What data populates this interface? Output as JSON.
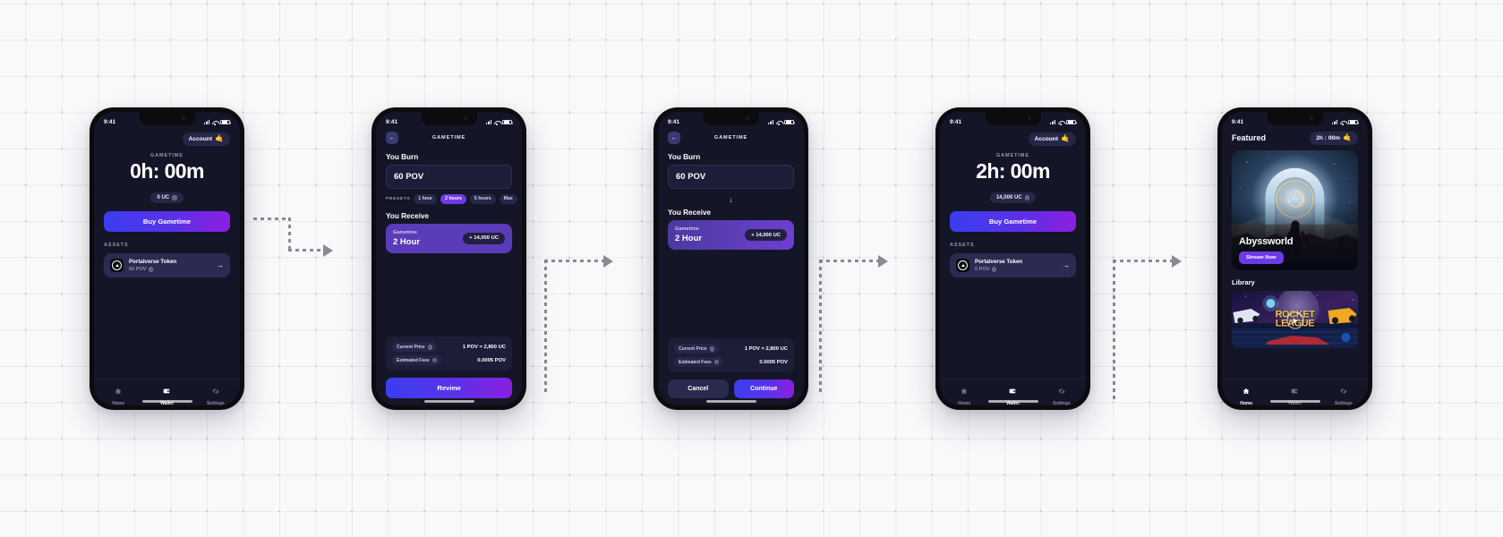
{
  "status_bar": {
    "time": "9:41"
  },
  "connectors": {
    "arrow_color": "#8a8a92"
  },
  "screens": [
    {
      "id": "wallet-empty",
      "header": {
        "account_label": "Account",
        "account_emoji": "🤙"
      },
      "gametime": {
        "caption": "GAMETIME",
        "value": "0h: 00m",
        "balance_pill": "0 UC"
      },
      "primary_button": "Buy Gametime",
      "assets": {
        "title": "ASSETS",
        "items": [
          {
            "name": "Portalverse Token",
            "amount": "60 POV"
          }
        ]
      },
      "tabs": [
        {
          "label": "Home",
          "icon": "home-icon",
          "active": false
        },
        {
          "label": "Wallet",
          "icon": "wallet-icon",
          "active": true
        },
        {
          "label": "Settings",
          "icon": "gear-icon",
          "active": false
        }
      ]
    },
    {
      "id": "swap-input",
      "nav": {
        "back_icon": "arrow-left-icon",
        "title": "GAMETIME"
      },
      "burn": {
        "label": "You Burn",
        "value": "60 POV"
      },
      "presets": {
        "label": "PRESETS",
        "options": [
          "1 hour",
          "2 hours",
          "5 hours",
          "Max"
        ],
        "selected": "2 hours"
      },
      "receive": {
        "label": "You Receive",
        "card_label": "Gametime",
        "card_value": "2 Hour",
        "badge": "+ 14,000 UC"
      },
      "info": [
        {
          "key": "Current Price",
          "value": "1 POV = 2,800 UC"
        },
        {
          "key": "Estimated Fees",
          "value": "0.0005 POV"
        }
      ],
      "primary_button": "Review"
    },
    {
      "id": "swap-review",
      "nav": {
        "back_icon": "arrow-left-icon",
        "title": "GAMETIME"
      },
      "burn": {
        "label": "You Burn",
        "value": "60 POV"
      },
      "divider_icon": "arrow-down-icon",
      "receive": {
        "label": "You Receive",
        "card_label": "Gametime",
        "card_value": "2 Hour",
        "badge": "+ 14,000 UC"
      },
      "info": [
        {
          "key": "Current Price",
          "value": "1 POV = 2,800 UC"
        },
        {
          "key": "Estimated Fees",
          "value": "0.0005 POV"
        }
      ],
      "cancel_button": "Cancel",
      "confirm_button": "Continue"
    },
    {
      "id": "wallet-funded",
      "header": {
        "account_label": "Account",
        "account_emoji": "🤙"
      },
      "gametime": {
        "caption": "GAMETIME",
        "value": "2h: 00m",
        "balance_pill": "14,000 UC"
      },
      "primary_button": "Buy Gametime",
      "assets": {
        "title": "ASSETS",
        "items": [
          {
            "name": "Portalverse Token",
            "amount": "0 POV"
          }
        ]
      },
      "tabs": [
        {
          "label": "Home",
          "icon": "home-icon",
          "active": false
        },
        {
          "label": "Wallet",
          "icon": "wallet-icon",
          "active": true
        },
        {
          "label": "Settings",
          "icon": "gear-icon",
          "active": false
        }
      ]
    },
    {
      "id": "home-featured",
      "header": {
        "title": "Featured",
        "time_pill": "2h : 00m",
        "emoji": "🤙"
      },
      "hero": {
        "game_title": "Abyssworld",
        "cta": "Stream Now"
      },
      "library": {
        "title": "Library",
        "items": [
          {
            "title_line1": "ROCKET",
            "title_line2": "LEAGUE"
          }
        ]
      },
      "tabs": [
        {
          "label": "Home",
          "icon": "home-icon",
          "active": true
        },
        {
          "label": "Wallet",
          "icon": "wallet-icon",
          "active": false
        },
        {
          "label": "Settings",
          "icon": "gear-icon",
          "active": false
        }
      ]
    }
  ]
}
